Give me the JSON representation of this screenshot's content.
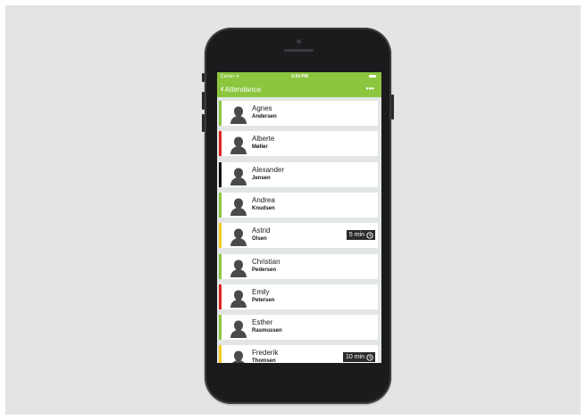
{
  "status_bar": {
    "carrier": "Carrier ᯤ",
    "time": "3:04 PM"
  },
  "navbar": {
    "back_label": "Attendance",
    "more_label": "•••",
    "color": "#8cc63f"
  },
  "students": [
    {
      "first": "Agnes",
      "last": "Andersen",
      "status_color": "#8cc63f",
      "timer": ""
    },
    {
      "first": "Alberte",
      "last": "Møller",
      "status_color": "#d9261c",
      "timer": ""
    },
    {
      "first": "Alexander",
      "last": "Jensen",
      "status_color": "#111111",
      "timer": ""
    },
    {
      "first": "Andrea",
      "last": "Knudsen",
      "status_color": "#8cc63f",
      "timer": ""
    },
    {
      "first": "Astrid",
      "last": "Olsen",
      "status_color": "#f5cb1a",
      "timer": "5 min"
    },
    {
      "first": "Christian",
      "last": "Pedersen",
      "status_color": "#8cc63f",
      "timer": ""
    },
    {
      "first": "Emily",
      "last": "Petersen",
      "status_color": "#d9261c",
      "timer": ""
    },
    {
      "first": "Esther",
      "last": "Rasmussen",
      "status_color": "#8cc63f",
      "timer": ""
    },
    {
      "first": "Frederik",
      "last": "Thomsen",
      "status_color": "#f5cb1a",
      "timer": "10 min"
    }
  ]
}
